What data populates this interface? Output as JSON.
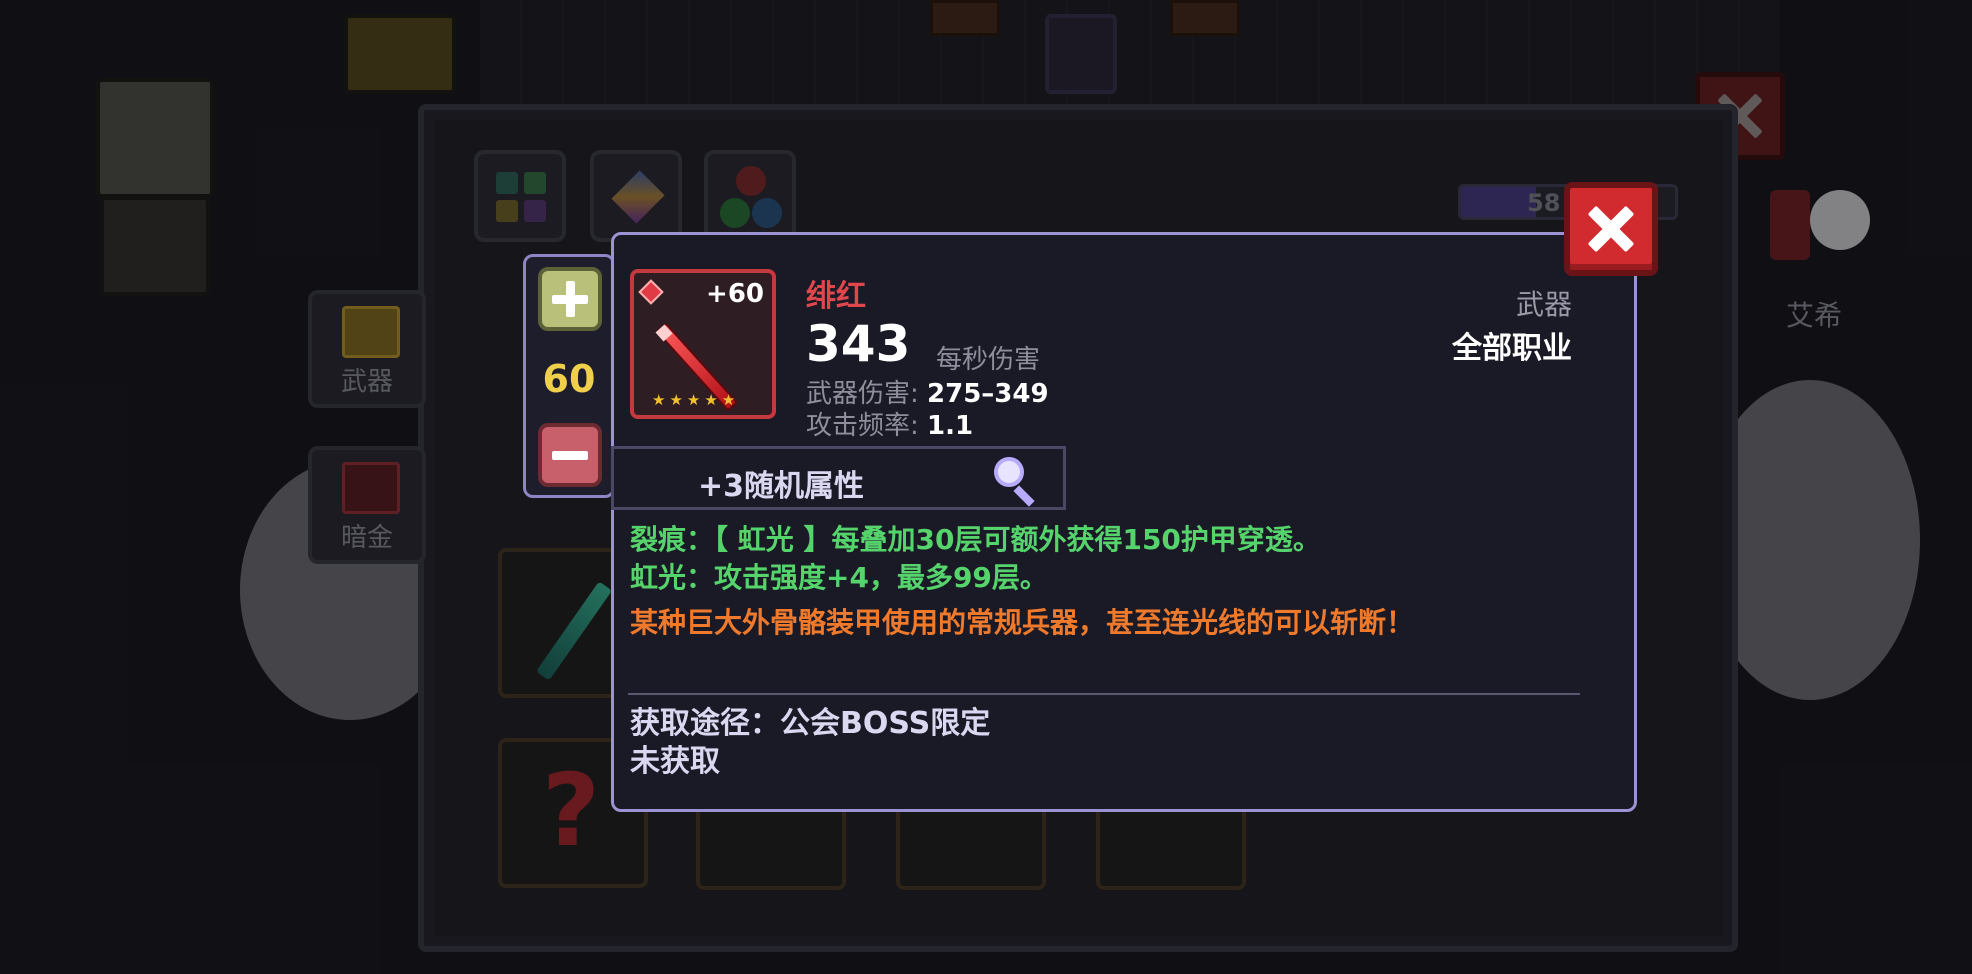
{
  "background": {
    "inventory_tabs": [
      {
        "icon": "grid-icon"
      },
      {
        "icon": "gem-icon"
      },
      {
        "icon": "orbs-icon"
      }
    ],
    "side_categories": [
      {
        "label": "武器",
        "icon": "weapon-chest-icon",
        "color": "#c9a22f"
      },
      {
        "label": "暗金",
        "icon": "dark-gold-chest-icon",
        "color": "#a8323a"
      }
    ],
    "exp_bar": {
      "text": "58",
      "fill_fraction": 0.35
    },
    "character_name": "艾希"
  },
  "stepper": {
    "plus_icon": "plus-icon",
    "minus_icon": "minus-icon",
    "value": "60"
  },
  "item": {
    "name": "绯红",
    "enhance": "+60",
    "stars": "★★★★★",
    "dps": "343",
    "dps_label": "每秒伤害",
    "damage_label": "武器伤害:",
    "damage_value": "275–349",
    "rate_label": "攻击频率:",
    "rate_value": "1.1",
    "type": "武器",
    "class": "全部职业",
    "random_attr": "+3随机属性",
    "effects": [
      "裂痕：【 虹光 】每叠加30层可额外获得150护甲穿透。",
      "虹光：攻击强度+4，最多99层。"
    ],
    "flavor": "某种巨大外骨骼装甲使用的常规兵器，甚至连光线的可以斩断！",
    "source": "获取途径：公会BOSS限定",
    "status": "未获取"
  },
  "colors": {
    "rarity_red": "#e0474d",
    "effect_green": "#56d46c",
    "flavor_orange": "#f07a2c",
    "popup_border": "#9b93d3",
    "level_yellow": "#f0cf4a"
  }
}
